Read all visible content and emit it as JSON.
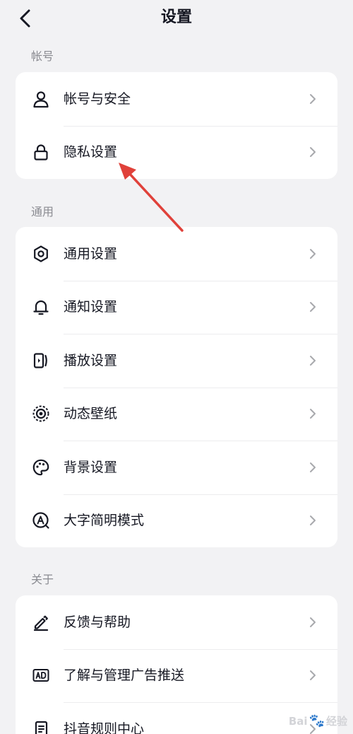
{
  "header": {
    "title": "设置",
    "back_icon": "chevron-left-icon"
  },
  "sections": [
    {
      "label": "帐号",
      "items": [
        {
          "label": "帐号与安全",
          "icon": "person-icon"
        },
        {
          "label": "隐私设置",
          "icon": "lock-icon"
        }
      ]
    },
    {
      "label": "通用",
      "items": [
        {
          "label": "通用设置",
          "icon": "gear-icon"
        },
        {
          "label": "通知设置",
          "icon": "bell-icon"
        },
        {
          "label": "播放设置",
          "icon": "playback-icon"
        },
        {
          "label": "动态壁纸",
          "icon": "live-wallpaper-icon"
        },
        {
          "label": "背景设置",
          "icon": "palette-icon"
        },
        {
          "label": "大字简明模式",
          "icon": "large-font-icon"
        }
      ]
    },
    {
      "label": "关于",
      "items": [
        {
          "label": "反馈与帮助",
          "icon": "pencil-icon"
        },
        {
          "label": "了解与管理广告推送",
          "icon": "ad-icon"
        },
        {
          "label": "抖音规则中心",
          "icon": "document-icon"
        }
      ]
    }
  ],
  "annotation": {
    "color": "#e0413a"
  },
  "watermark": {
    "brand": "Bai",
    "suffix": "经验"
  }
}
